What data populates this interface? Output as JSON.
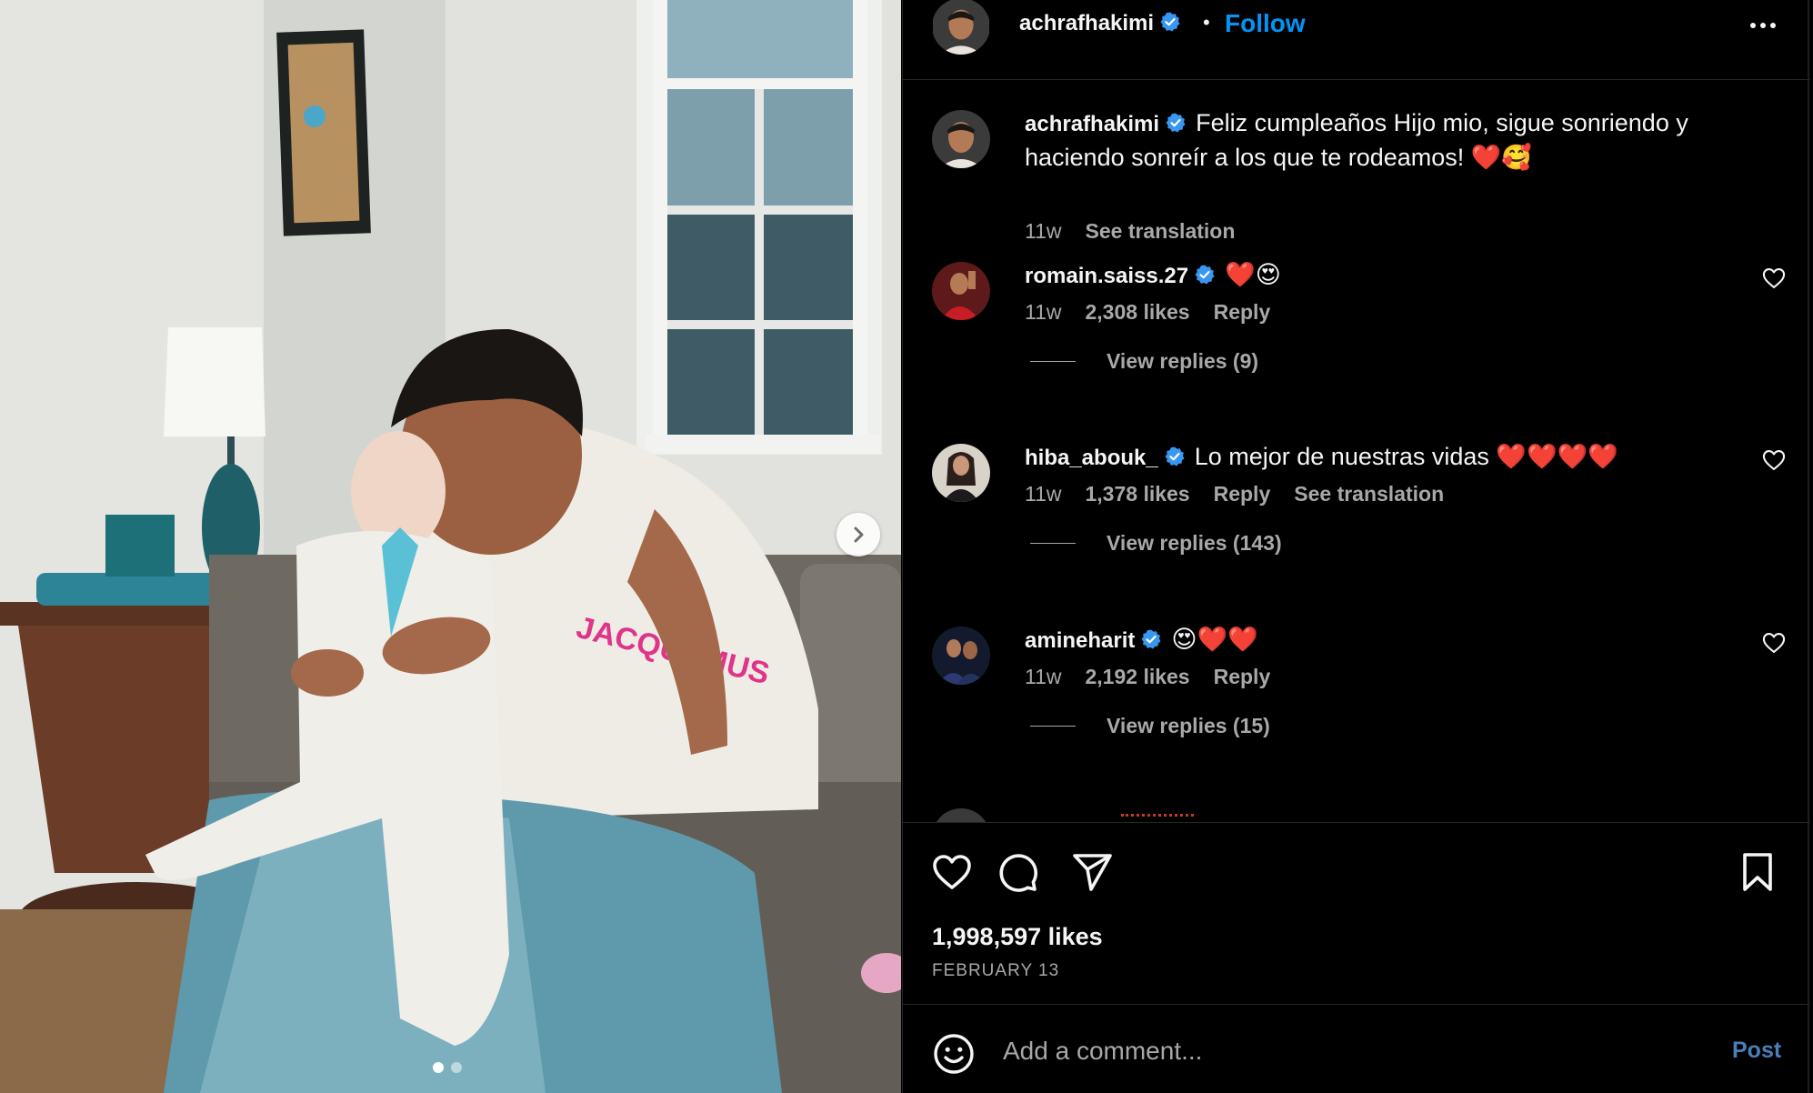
{
  "post": {
    "username": "achrafhakimi",
    "separator": "•",
    "follow_label": "Follow",
    "caption": "Feliz cumpleaños Hijo mio, sigue sonriendo y haciendo sonreír a los que te rodeamos! ❤️🥰",
    "caption_time": "11w",
    "caption_translate": "See translation",
    "likes": "1,998,597 likes",
    "date": "FEBRUARY 13",
    "carousel": {
      "total": 2,
      "current": 1
    }
  },
  "comments": [
    {
      "username": "romain.saiss.27",
      "text": "❤️😍",
      "time": "11w",
      "likes": "2,308 likes",
      "reply": "Reply",
      "view_replies": "View replies (9)"
    },
    {
      "username": "hiba_abouk_",
      "text": "Lo mejor de nuestras vidas ❤️❤️❤️❤️",
      "time": "11w",
      "likes": "1,378 likes",
      "reply": "Reply",
      "translate": "See translation",
      "view_replies": "View replies (143)"
    },
    {
      "username": "amineharit",
      "text": "😍❤️❤️",
      "time": "11w",
      "likes": "2,192 likes",
      "reply": "Reply",
      "view_replies": "View replies (15)"
    }
  ],
  "composer": {
    "placeholder": "Add a comment...",
    "post_label": "Post"
  },
  "icons": {
    "like": "heart-icon",
    "comment": "comment-bubble-icon",
    "share": "paper-plane-icon",
    "save": "bookmark-icon",
    "emoji": "smiley-icon",
    "more": "ellipsis-icon",
    "next": "chevron-right-icon",
    "verified": "verified-badge-icon"
  },
  "colors": {
    "accent": "#0095f6",
    "verified": "#0095f6",
    "background": "#000000",
    "muted_text": "#a8a8a8"
  }
}
